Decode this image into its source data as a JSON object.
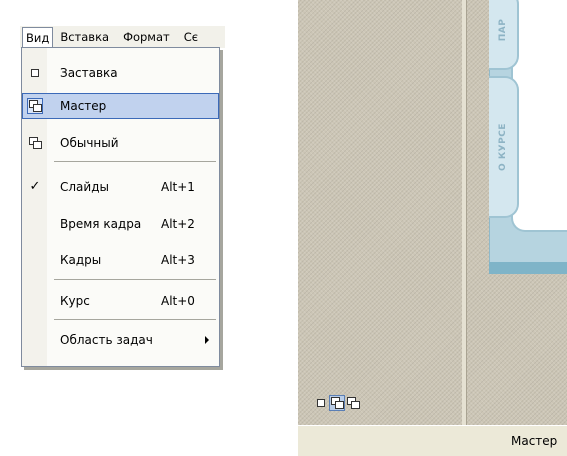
{
  "menu_bar": {
    "items": [
      {
        "label": "Вид",
        "open": true
      },
      {
        "label": "Вставка"
      },
      {
        "label": "Формат"
      },
      {
        "label": "Сє"
      }
    ]
  },
  "view_menu": {
    "items": [
      {
        "label": "Заставка",
        "icon": "single-window-icon",
        "shortcut": ""
      },
      {
        "label": "Мастер",
        "icon": "stacked-windows-icon",
        "shortcut": "",
        "highlighted": true
      },
      {
        "label": "Обычный",
        "icon": "stacked-windows-small-icon",
        "shortcut": ""
      },
      {
        "label": "Слайды",
        "icon": "check-icon",
        "shortcut": "Alt+1",
        "checked": true
      },
      {
        "label": "Время кадра",
        "shortcut": "Alt+2"
      },
      {
        "label": "Кадры",
        "shortcut": "Alt+3"
      },
      {
        "label": "Курс",
        "shortcut": "Alt+0"
      },
      {
        "label": "Область задач",
        "submenu": true
      }
    ]
  },
  "slide_tabs": [
    {
      "label": "ПАР"
    },
    {
      "label": "О КУРСЕ"
    }
  ],
  "status_bar": {
    "text": "Мастер"
  },
  "colors": {
    "menu_highlight": "#c1d2ee",
    "menu_highlight_border": "#3c6ab8",
    "slide_frame": "#b6d4e0",
    "slide_tab_text": "#8db3c4",
    "pane_background": "#ccc6b6",
    "chrome": "#ece9d8"
  }
}
